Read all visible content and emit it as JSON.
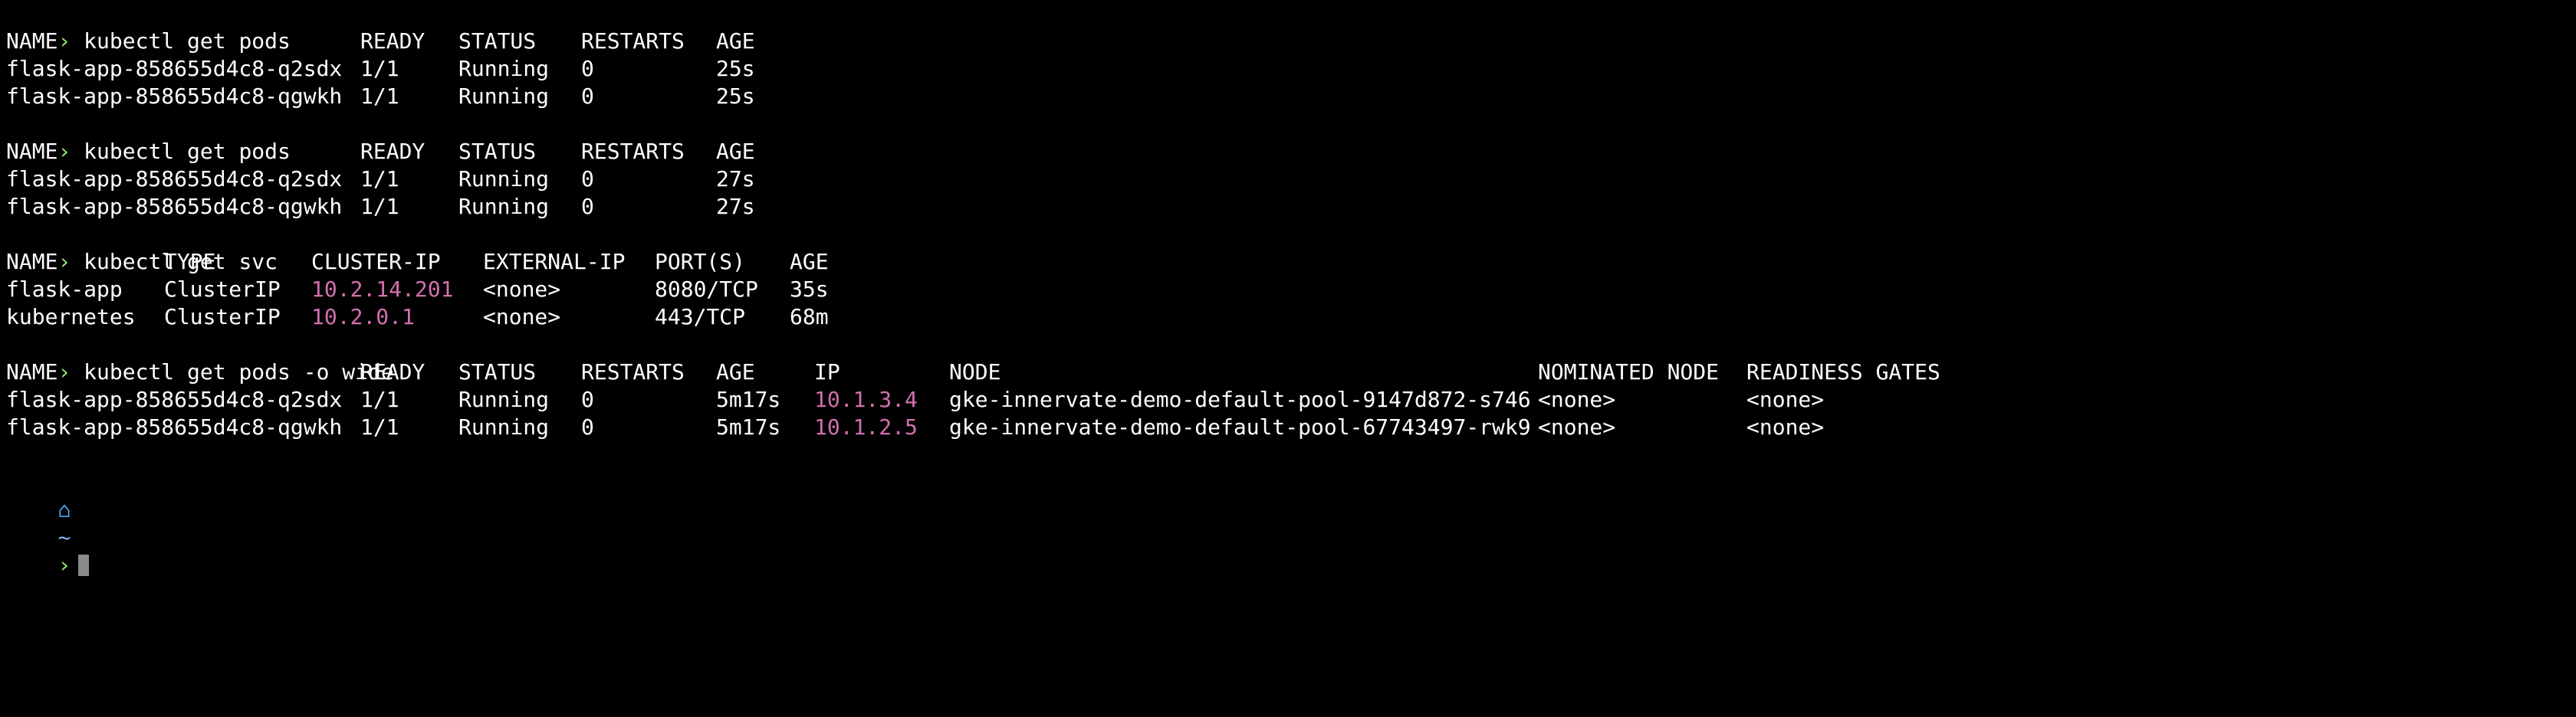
{
  "prompt_symbol": "›",
  "commands": {
    "c1": "kubectl get pods",
    "c2": "kubectl get pods",
    "c3": "kubectl get svc",
    "c4": "kubectl get pods -o wide"
  },
  "pods1": {
    "headers": [
      "NAME",
      "READY",
      "STATUS",
      "RESTARTS",
      "AGE"
    ],
    "rows": [
      [
        "flask-app-858655d4c8-q2sdx",
        "1/1",
        "Running",
        "0",
        "25s"
      ],
      [
        "flask-app-858655d4c8-qgwkh",
        "1/1",
        "Running",
        "0",
        "25s"
      ]
    ]
  },
  "pods2": {
    "headers": [
      "NAME",
      "READY",
      "STATUS",
      "RESTARTS",
      "AGE"
    ],
    "rows": [
      [
        "flask-app-858655d4c8-q2sdx",
        "1/1",
        "Running",
        "0",
        "27s"
      ],
      [
        "flask-app-858655d4c8-qgwkh",
        "1/1",
        "Running",
        "0",
        "27s"
      ]
    ]
  },
  "svc": {
    "headers": [
      "NAME",
      "TYPE",
      "CLUSTER-IP",
      "EXTERNAL-IP",
      "PORT(S)",
      "AGE"
    ],
    "rows": [
      [
        "flask-app",
        "ClusterIP",
        "10.2.14.201",
        "<none>",
        "8080/TCP",
        "35s"
      ],
      [
        "kubernetes",
        "ClusterIP",
        "10.2.0.1",
        "<none>",
        "443/TCP",
        "68m"
      ]
    ]
  },
  "pods_wide": {
    "headers": [
      "NAME",
      "READY",
      "STATUS",
      "RESTARTS",
      "AGE",
      "IP",
      "NODE",
      "NOMINATED NODE",
      "READINESS GATES"
    ],
    "rows": [
      [
        "flask-app-858655d4c8-q2sdx",
        "1/1",
        "Running",
        "0",
        "5m17s",
        "10.1.3.4",
        "gke-innervate-demo-default-pool-9147d872-s746",
        "<none>",
        "<none>"
      ],
      [
        "flask-app-858655d4c8-qgwkh",
        "1/1",
        "Running",
        "0",
        "5m17s",
        "10.1.2.5",
        "gke-innervate-demo-default-pool-67743497-rwk9",
        "<none>",
        "<none>"
      ]
    ]
  },
  "status_line": {
    "apple_glyph": "",
    "home_glyph": "⌂",
    "tilde": "~",
    "arrow": "›"
  },
  "colors": {
    "background": "#000000",
    "text": "#ffffff",
    "prompt_arrow": "#8ee86e",
    "ip": "#d36fae",
    "home_icon": "#4aa8ff",
    "cursor": "#8a8a8a"
  }
}
